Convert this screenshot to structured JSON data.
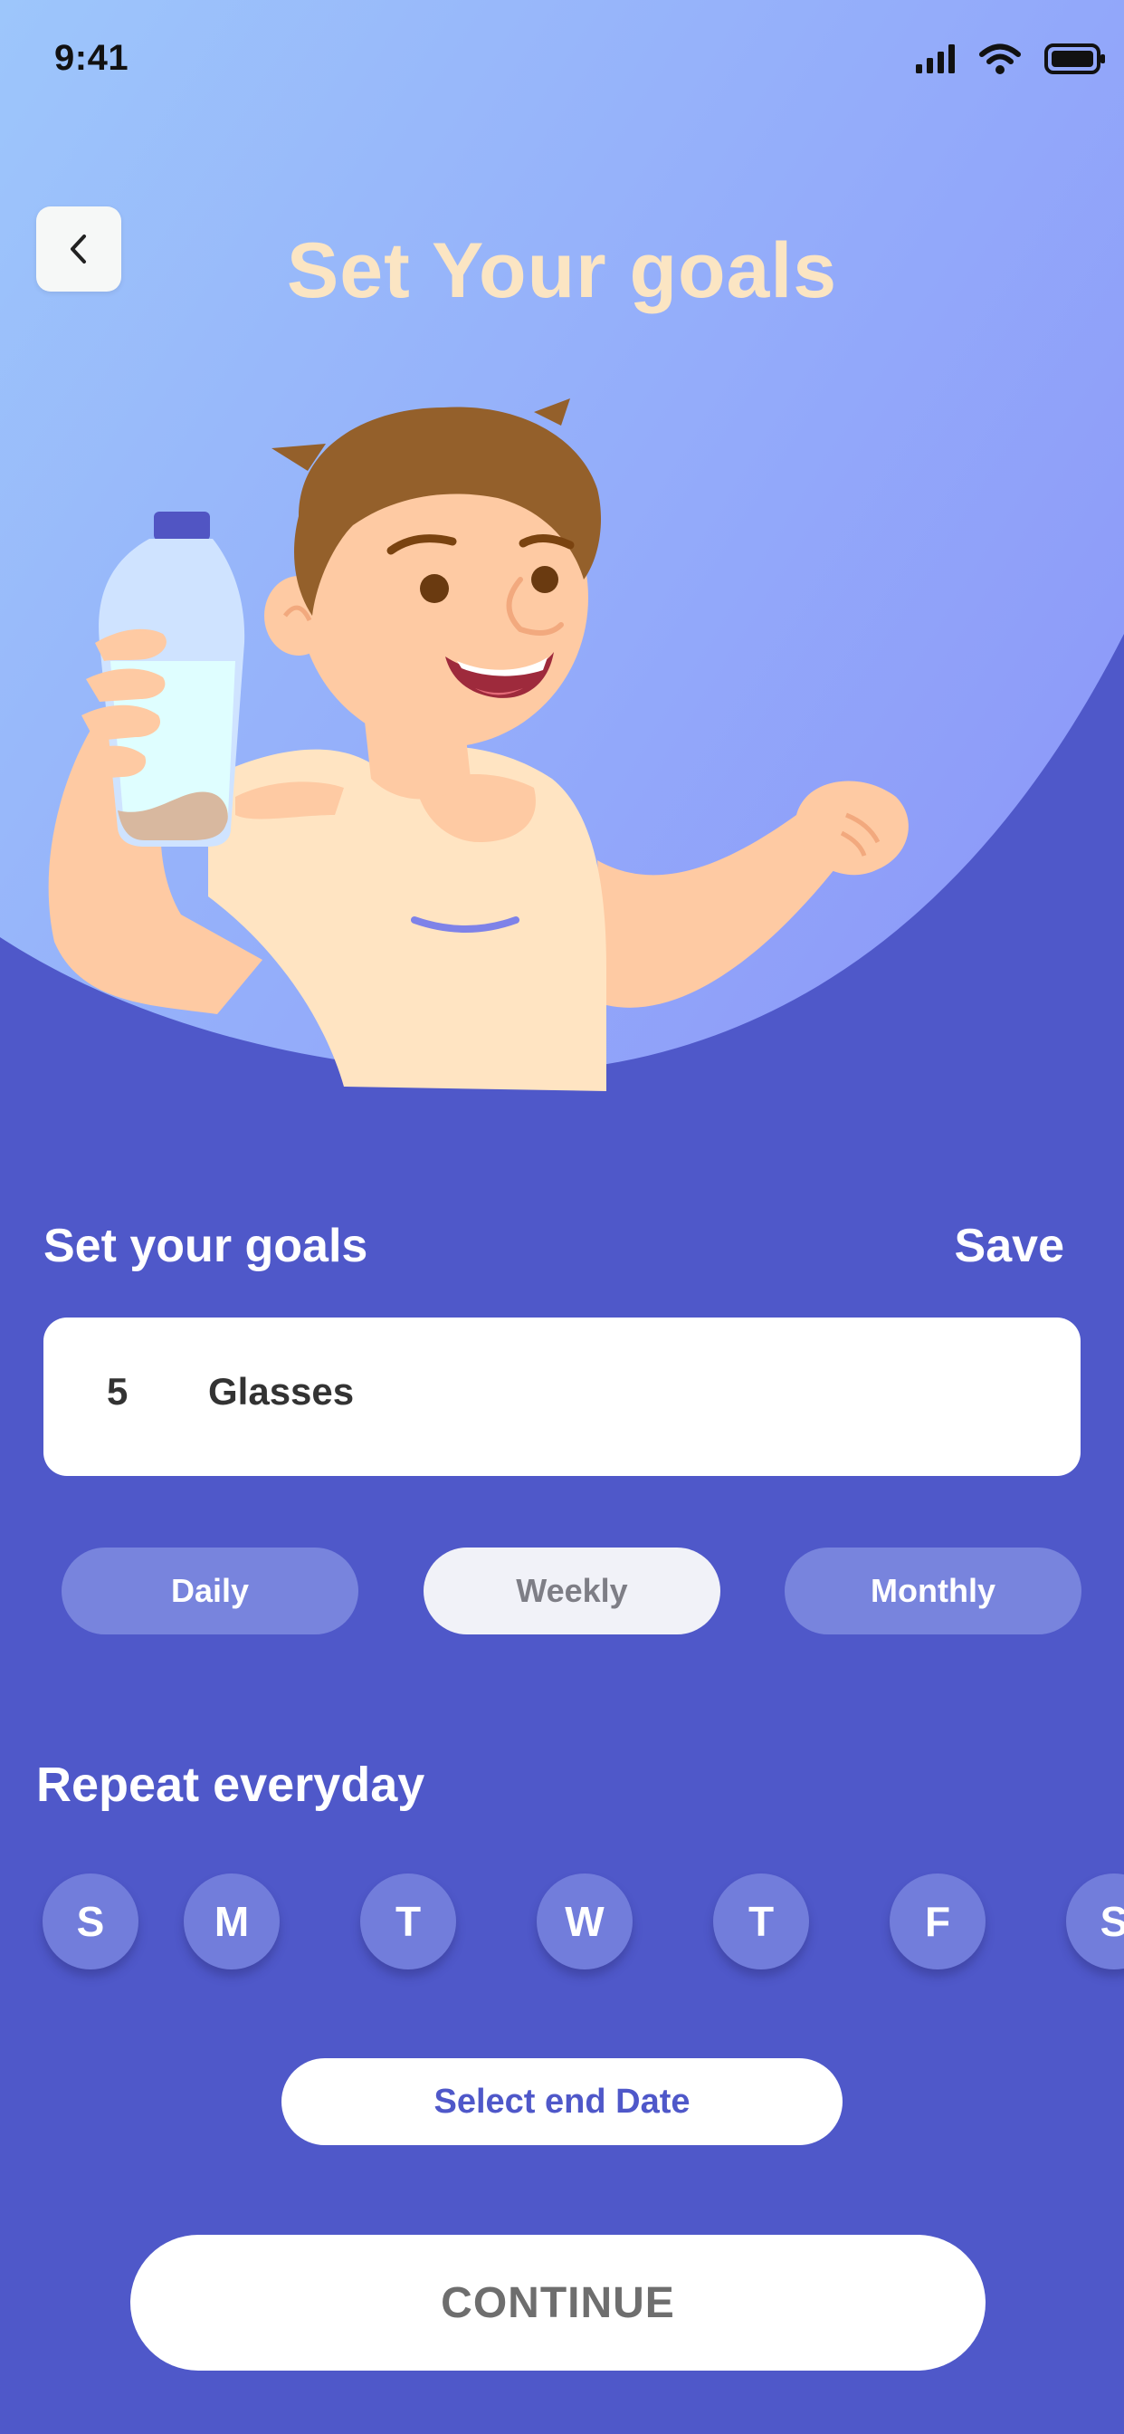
{
  "status_bar": {
    "time": "9:41"
  },
  "header": {
    "title": "Set Your goals"
  },
  "goals": {
    "section_title": "Set your goals",
    "save_label": "Save",
    "quantity": "5",
    "unit": "Glasses"
  },
  "periods": {
    "selected": "Weekly",
    "daily": "Daily",
    "weekly": "Weekly",
    "monthly": "Monthly"
  },
  "repeat": {
    "title": "Repeat everyday",
    "days": [
      "S",
      "M",
      "T",
      "W",
      "T",
      "F",
      "S"
    ]
  },
  "actions": {
    "end_date_label": "Select end Date",
    "continue_label": "CONTINUE"
  },
  "colors": {
    "background": "#4F58C9",
    "hero_gradient_start": "#9DC6FB",
    "hero_gradient_end": "#8E9CF9",
    "title": "#FBE5C3",
    "pill": "#7884DD",
    "pill_selected": "#F1F2F8"
  },
  "icons": {
    "back": "chevron-left-icon",
    "signal": "cellular-signal-icon",
    "wifi": "wifi-icon",
    "battery": "battery-icon"
  }
}
